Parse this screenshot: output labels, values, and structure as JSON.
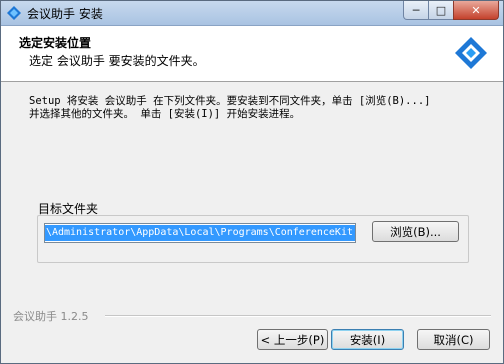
{
  "window": {
    "title": "会议助手 安装",
    "minimize_glyph": "─",
    "maximize_glyph": "□",
    "close_glyph": "✕"
  },
  "header": {
    "title": "选定安装位置",
    "subtitle": "选定 会议助手 要安装的文件夹。",
    "logo_icon": "diamond-logo-icon",
    "accent_color": "#1e78d6"
  },
  "body": {
    "description": "Setup 将安装 会议助手 在下列文件夹。要安装到不同文件夹，单击 [浏览(B)...]\n并选择其他的文件夹。 单击 [安装(I)] 开始安装进程。",
    "destination": {
      "label": "目标文件夹",
      "value": "s\\Administrator\\AppData\\Local\\Programs\\ConferenceKit",
      "browse_label": "浏览(B)..."
    }
  },
  "footer": {
    "brand": "会议助手 1.2.5",
    "back_label": "< 上一步(P)",
    "install_label": "安装(I)",
    "cancel_label": "取消(C)"
  }
}
